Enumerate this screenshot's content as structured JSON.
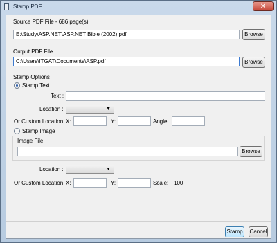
{
  "window": {
    "title": "Stamp PDF",
    "close_glyph": "✕"
  },
  "source": {
    "label": "Source PDF File - 686 page(s)",
    "path": "E:\\Study\\ASP.NET\\ASP.NET Bible (2002).pdf",
    "browse": "Browse"
  },
  "output": {
    "label": "Output PDF File",
    "path": "C:\\Users\\ITGAT\\Documents\\ASP.pdf",
    "browse": "Browse"
  },
  "options": {
    "heading": "Stamp Options",
    "stamp_text": {
      "label": "Stamp Text",
      "selected": true,
      "text_label": "Text :",
      "text_value": "",
      "location_label": "Location :",
      "location_value": "",
      "custom_label": "Or Custom Location",
      "x_label": "X:",
      "x_value": "",
      "y_label": "Y:",
      "y_value": "",
      "angle_label": "Angle:",
      "angle_value": ""
    },
    "stamp_image": {
      "label": "Stamp Image",
      "selected": false,
      "image_file_label": "Image File",
      "image_file_value": "",
      "browse": "Browse",
      "location_label": "Location :",
      "location_value": "",
      "custom_label": "Or Custom Location",
      "x_label": "X:",
      "x_value": "",
      "y_label": "Y:",
      "y_value": "",
      "scale_label": "Scale:",
      "scale_value": "100"
    }
  },
  "footer": {
    "stamp": "Stamp",
    "cancel": "Cancel"
  },
  "colors": {
    "title_bar": "#c9d9ea",
    "dialog_bg": "#f0f0f0",
    "close_button": "#c6483a",
    "focus_border": "#3d7bd1"
  }
}
